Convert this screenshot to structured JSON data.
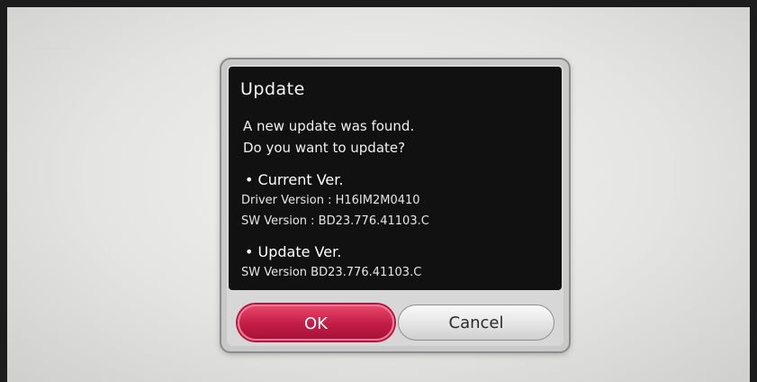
{
  "dialog": {
    "title": "Update",
    "message_line1": "A new update was found.",
    "message_line2": "Do you want to update?",
    "current": {
      "heading": "• Current Ver.",
      "driver_version": "Driver Version : H16IM2M0410",
      "sw_version": "SW Version : BD23.776.41103.C"
    },
    "update": {
      "heading": "• Update Ver.",
      "sw_version": "SW Version BD23.776.41103.C"
    },
    "ok_label": "OK",
    "cancel_label": "Cancel"
  },
  "colors": {
    "ok_button": "#c21c45",
    "panel_background": "#111111",
    "screen_background": "#e8e8e6"
  }
}
